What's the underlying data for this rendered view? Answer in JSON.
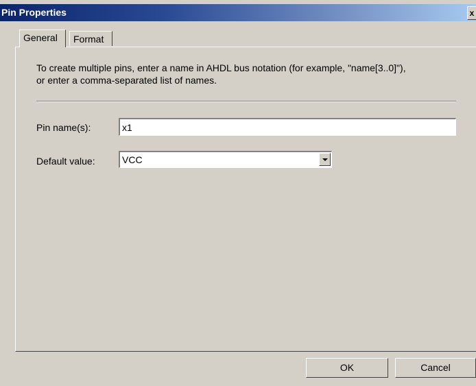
{
  "window": {
    "title": "Pin Properties",
    "close_label": "x"
  },
  "tabs": [
    {
      "label": "General",
      "active": true
    },
    {
      "label": "Format",
      "active": false
    }
  ],
  "general": {
    "instructions_line1": "To create multiple pins, enter a name in AHDL bus notation (for example, \"name[3..0]\"),",
    "instructions_line2": "or enter a comma-separated list of names.",
    "pin_name_label": "Pin name(s):",
    "pin_name_value": "x1",
    "default_value_label": "Default value:",
    "default_value_selected": "VCC"
  },
  "buttons": {
    "ok": "OK",
    "cancel": "Cancel"
  },
  "colors": {
    "face": "#d4d0c8",
    "title_start": "#0a246a",
    "title_end": "#a6caf0"
  }
}
